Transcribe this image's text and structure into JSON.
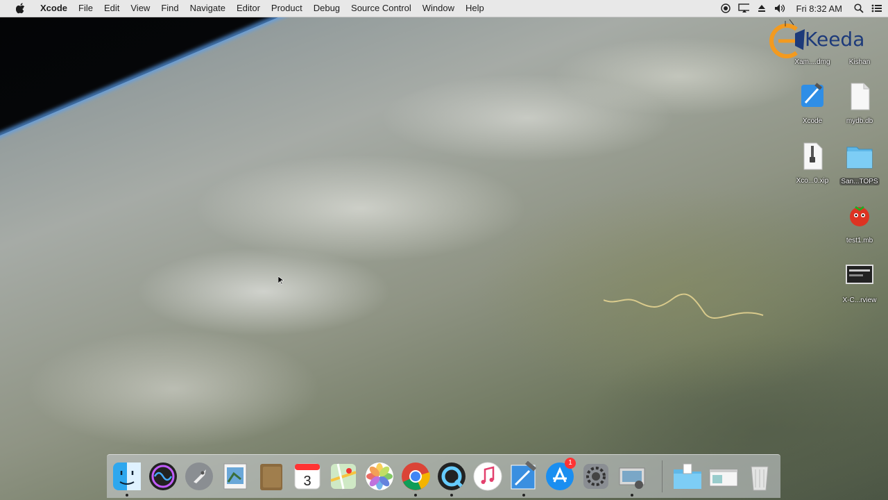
{
  "menubar": {
    "app_name": "Xcode",
    "items": [
      "File",
      "Edit",
      "View",
      "Find",
      "Navigate",
      "Editor",
      "Product",
      "Debug",
      "Source Control",
      "Window",
      "Help"
    ],
    "clock": "Fri 8:32 AM"
  },
  "watermark": {
    "text": "Keeda"
  },
  "desktop_icons": [
    {
      "label": "Xam....dmg"
    },
    {
      "label": "Kishan"
    },
    {
      "label": "Xcode"
    },
    {
      "label": "mydb.db"
    },
    {
      "label": "Xco...0.xip"
    },
    {
      "label": "San...TOPS"
    },
    {
      "label": "test1.mb"
    },
    {
      "label": "X-C...rview"
    }
  ],
  "dock": {
    "apps": [
      "Finder",
      "Siri",
      "Launchpad",
      "Preview",
      "Notes",
      "Calendar",
      "Maps",
      "Photos",
      "Chrome",
      "QuickTime",
      "iTunes",
      "Xcode",
      "App Store",
      "System Preferences",
      "Image Capture"
    ],
    "calendar_day": "3",
    "app_store_badge": "1"
  },
  "colors": {
    "menubar_bg": "#e8e8e8",
    "dock_bg": "#d2d6da"
  }
}
